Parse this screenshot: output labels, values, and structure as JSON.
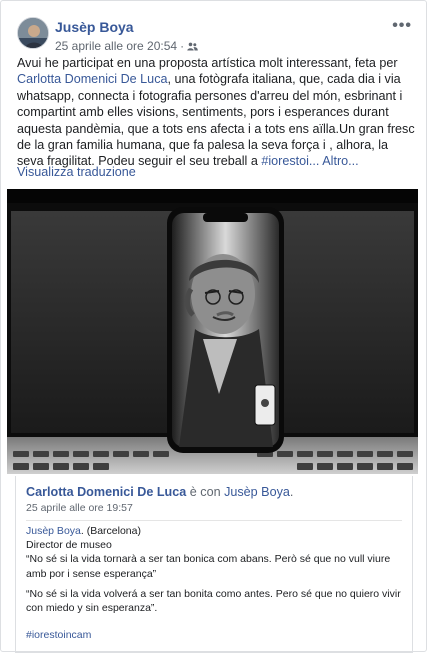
{
  "post": {
    "author": "Jusèp Boya",
    "timestamp": "25 aprile alle ore 20:54",
    "sep": "·",
    "text_before_link": "Avui he participat en una proposta artística molt interessant, feta per",
    "mention": "Carlotta Domenici De Luca",
    "text_after_link": ", una fotògrafa italiana, que, cada dia i via whatsapp, connecta i fotografia persones d'arreu del món, esbrinant i compartint amb elles visions, sentiments, pors i esperances durant aquesta pandèmia, que a tots ens afecta i a tots ens aïlla.Un gran fresc de la gran familia humana, que fa palesa la seva força i , alhora, la seva fragilitat. Podeu seguir el seu treball a",
    "hashtag_truncated": "#iorestoi...",
    "more": "Altro...",
    "translate": "Visualizza traduzione"
  },
  "shared": {
    "author": "Carlotta Domenici De Luca",
    "with_text": "è con",
    "with_name": "Jusèp Boya",
    "period": ".",
    "timestamp": "25 aprile alle ore 19:57",
    "line1_name": "Jusèp Boya",
    "line1_rest": ". (Barcelona)",
    "line2": "Director de museo",
    "quote_it": "“No sé si la vida tornarà a ser tan bonica com abans. Però sé que no vull viure amb por i sense esperança”",
    "quote_es": "“No sé si la vida volverá a ser tan bonita como antes. Pero sé que no quiero vivir con miedo y sin esperanza”.",
    "hashtag": "#iorestoincam"
  },
  "icons": {
    "audience": "friends-icon",
    "more": "more-options-icon"
  },
  "colors": {
    "link": "#385898",
    "meta": "#606770",
    "text": "#1c1e21",
    "border": "#dddfe2"
  }
}
